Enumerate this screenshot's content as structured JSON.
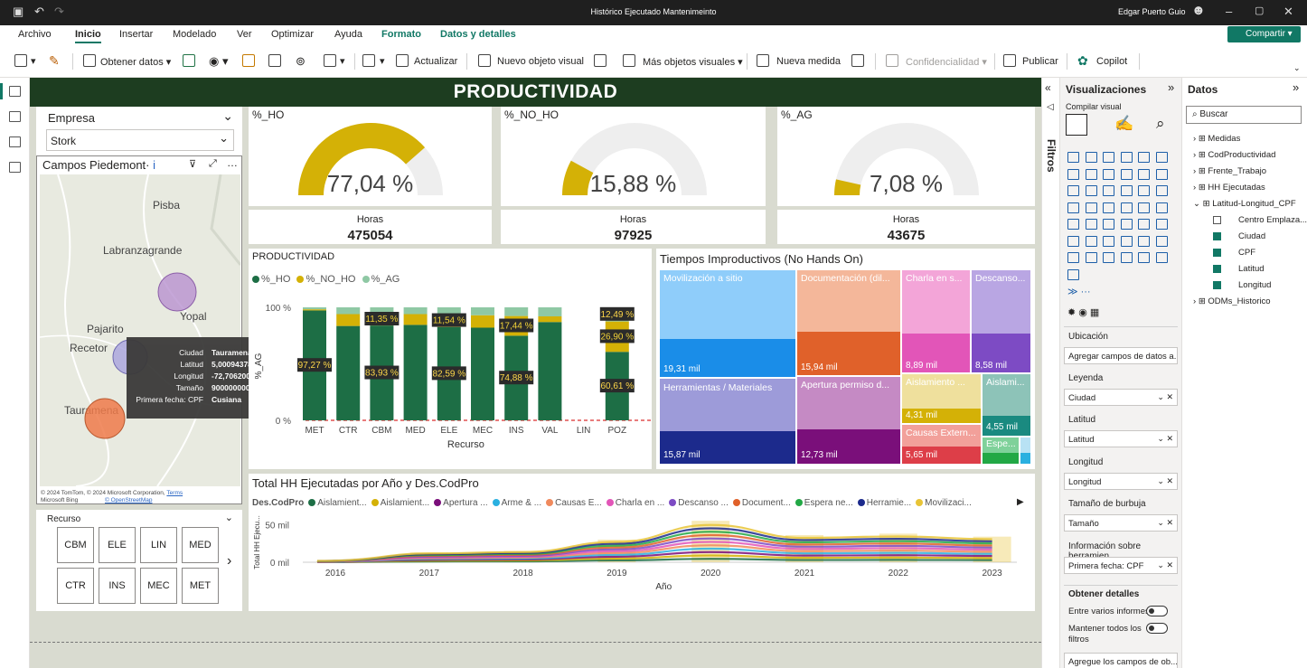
{
  "window": {
    "title": "Histórico Ejecutado Mantenimeinto",
    "user": "Edgar Puerto Guio"
  },
  "menu": [
    "Archivo",
    "Inicio",
    "Insertar",
    "Modelado",
    "Ver",
    "Optimizar",
    "Ayuda",
    "Formato",
    "Datos y detalles"
  ],
  "share_label": "Compartir",
  "ribbon": {
    "obtener": "Obtener datos",
    "actualizar": "Actualizar",
    "nuevo_visual": "Nuevo objeto visual",
    "mas_visuales": "Más objetos visuales",
    "nueva_medida": "Nueva medida",
    "confidencialidad": "Confidencialidad",
    "publicar": "Publicar",
    "copilot": "Copilot"
  },
  "header": "PRODUCTIVIDAD",
  "slicer_empresa": {
    "label": "Empresa",
    "value": "Stork"
  },
  "map": {
    "title": "Campos Piedemont·",
    "places": [
      "Pisba",
      "Labranzagrande",
      "Yopal",
      "Pajarito",
      "Recetor",
      "Tauramena"
    ],
    "attribution": "© 2024 TomTom, © 2024 Microsoft Corporation,",
    "terms": "Terms",
    "bing": "Microsoft Bing",
    "osm": "© OpenStreetMap",
    "tooltip": [
      {
        "k": "Ciudad",
        "v": "Tauramena"
      },
      {
        "k": "Latitud",
        "v": "5,00094378666"
      },
      {
        "k": "Longitud",
        "v": "-72,7062007108"
      },
      {
        "k": "Tamaño",
        "v": "9000000000"
      },
      {
        "k": "Primera fecha: CPF",
        "v": "Cusiana"
      }
    ]
  },
  "gauges": [
    {
      "title": "%_HO",
      "value": "77,04 %",
      "fraction": 0.7704,
      "horas_label": "Horas",
      "horas": "475054"
    },
    {
      "title": "%_NO_HO",
      "value": "15,88 %",
      "fraction": 0.1588,
      "horas_label": "Horas",
      "horas": "97925"
    },
    {
      "title": "%_AG",
      "value": "7,08 %",
      "fraction": 0.0708,
      "horas_label": "Horas",
      "horas": "43675"
    }
  ],
  "recurso_slicer": {
    "label": "Recurso",
    "tiles": [
      "CBM",
      "ELE",
      "LIN",
      "MED",
      "CTR",
      "INS",
      "MEC",
      "MET"
    ]
  },
  "colors": {
    "ho": "#1d6e45",
    "noho": "#d4b106",
    "ag": "#8fc8a4",
    "header": "#1d3d20",
    "accent": "#117865"
  },
  "chart_data": [
    {
      "type": "bar",
      "title": "PRODUCTIVIDAD",
      "legend": [
        "%_HO",
        "%_NO_HO",
        "%_AG"
      ],
      "xlabel": "Recurso",
      "ylabel": "%_AG",
      "yticks": [
        "100 %",
        "0 %"
      ],
      "ylim": [
        0,
        100
      ],
      "categories": [
        "MET",
        "CTR",
        "CBM",
        "MED",
        "ELE",
        "MEC",
        "INS",
        "VAL",
        "LIN",
        "POZ"
      ],
      "series": [
        {
          "name": "%_HO",
          "values": [
            97.27,
            83.5,
            83.93,
            84.5,
            82.59,
            82.0,
            74.88,
            87.0,
            0,
            60.61
          ]
        },
        {
          "name": "%_NO_HO",
          "values": [
            1.0,
            10.5,
            11.35,
            9.5,
            11.54,
            11.0,
            17.44,
            5.0,
            0,
            26.9
          ]
        },
        {
          "name": "%_AG",
          "values": [
            1.73,
            6.0,
            4.72,
            6.0,
            5.87,
            7.0,
            7.68,
            8.0,
            0,
            12.49
          ]
        }
      ],
      "data_labels": [
        {
          "cat": "MET",
          "text": "97,27 %"
        },
        {
          "cat": "CBM",
          "text": "11,35 %"
        },
        {
          "cat": "CBM",
          "text": "83,93 %"
        },
        {
          "cat": "ELE",
          "text": "11,54 %"
        },
        {
          "cat": "ELE",
          "text": "82,59 %"
        },
        {
          "cat": "INS",
          "text": "17,44 %"
        },
        {
          "cat": "INS",
          "text": "74,88 %"
        },
        {
          "cat": "POZ",
          "text": "12,49 %"
        },
        {
          "cat": "POZ",
          "text": "26,90 %"
        },
        {
          "cat": "POZ",
          "text": "60,61 %"
        }
      ]
    },
    {
      "type": "treemap",
      "title": "Tiempos Improductivos (No Hands On)",
      "items": [
        {
          "name": "Movilización a sitio",
          "value": "19,31 mil"
        },
        {
          "name": "Herramientas / Materiales",
          "value": "15,87 mil"
        },
        {
          "name": "Documentación (dil...",
          "value": "15,94 mil"
        },
        {
          "name": "Apertura permiso d...",
          "value": "12,73 mil"
        },
        {
          "name": "Charla en s...",
          "value": "8,89 mil"
        },
        {
          "name": "Descanso...",
          "value": "8,58 mil"
        },
        {
          "name": "Aislamiento ...",
          "value": "4,31 mil"
        },
        {
          "name": "Aislami...",
          "value": "4,55 mil"
        },
        {
          "name": "Causas Extern...",
          "value": "5,65 mil"
        },
        {
          "name": "Espe...",
          "value": ""
        }
      ]
    },
    {
      "type": "area",
      "title": "Total HH Ejecutadas por Año y Des.CodPro",
      "legend_title": "Des.CodPro",
      "legend": [
        "Aislamient...",
        "Aislamient...",
        "Apertura ...",
        "Arme & ...",
        "Causas E...",
        "Charla en ...",
        "Descanso ...",
        "Document...",
        "Espera ne...",
        "Herramie...",
        "Movilizaci..."
      ],
      "legend_colors": [
        "#1d6e45",
        "#d4b106",
        "#7a0f7a",
        "#2ab0e0",
        "#f08a5d",
        "#e255b8",
        "#7d4bc4",
        "#e0612a",
        "#22a845",
        "#1c2a8c",
        "#e8c436"
      ],
      "xlabel": "Año",
      "ylabel": "Total HH Ejecu...",
      "yticks": [
        "50 mil",
        "0 mil"
      ],
      "x": [
        "2016",
        "2017",
        "2018",
        "2019",
        "2020",
        "2021",
        "2022",
        "2023"
      ],
      "totals": [
        2000,
        13000,
        15000,
        30000,
        55000,
        36000,
        38000,
        34000
      ]
    }
  ],
  "panes": {
    "filtros": "Filtros",
    "viz": {
      "title": "Visualizaciones",
      "compilar": "Compilar visual"
    },
    "wells": [
      {
        "label": "Ubicación",
        "value": "Agregar campos de datos a..."
      },
      {
        "label": "Leyenda",
        "value": "Ciudad"
      },
      {
        "label": "Latitud",
        "value": "Latitud"
      },
      {
        "label": "Longitud",
        "value": "Longitud"
      },
      {
        "label": "Tamaño de burbuja",
        "value": "Tamaño"
      },
      {
        "label": "Información sobre herramien...",
        "value": "Primera fecha: CPF"
      }
    ],
    "drill": {
      "title": "Obtener detalles",
      "cross": "Entre varios informes",
      "keep": "Mantener todos los filtros",
      "add": "Agregue los campos de ob..."
    },
    "datos": {
      "title": "Datos",
      "search": "Buscar",
      "tables": [
        "Medidas",
        "CodProductividad",
        "Frente_Trabajo",
        "HH Ejecutadas",
        "Latitud-Longitud_CPF"
      ],
      "fields": [
        {
          "name": "Centro Emplaza...",
          "checked": false
        },
        {
          "name": "Ciudad",
          "checked": true
        },
        {
          "name": "CPF",
          "checked": true
        },
        {
          "name": "Latitud",
          "checked": true
        },
        {
          "name": "Longitud",
          "checked": true
        }
      ],
      "last_table": "ODMs_Historico"
    }
  }
}
